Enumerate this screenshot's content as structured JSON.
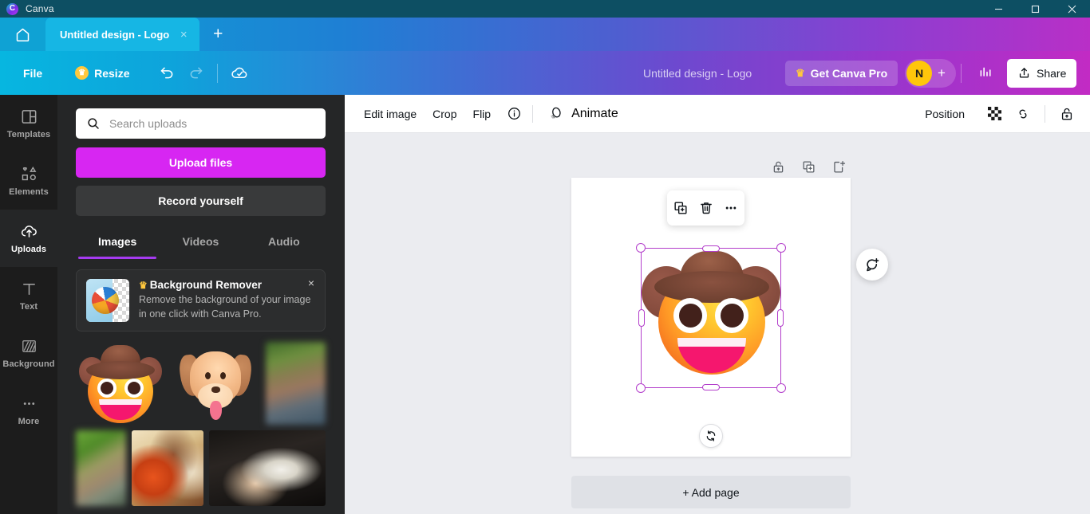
{
  "window": {
    "app_name": "Canva",
    "logo_letter": "C",
    "controls": {
      "minimize": "minimize-icon",
      "maximize": "maximize-icon",
      "close": "close-icon"
    }
  },
  "tabs": {
    "home_icon": "home-icon",
    "items": [
      {
        "label": "Untitled design - Logo",
        "active": true,
        "close": "×"
      }
    ],
    "new_tab": "+"
  },
  "toolbar": {
    "file_label": "File",
    "resize_label": "Resize",
    "resize_crown": "♛",
    "undo_icon": "undo-icon",
    "redo_icon": "redo-icon",
    "cloud_icon": "cloud-saved-icon",
    "doc_title": "Untitled design - Logo",
    "pro_label": "Get Canva Pro",
    "pro_crown": "♛",
    "avatar_initial": "N",
    "avatar_plus": "+",
    "stats_icon": "stats-icon",
    "share_label": "Share"
  },
  "rail": {
    "items": [
      {
        "label": "Templates",
        "icon": "templates-icon",
        "active": false
      },
      {
        "label": "Elements",
        "icon": "elements-icon",
        "active": false
      },
      {
        "label": "Uploads",
        "icon": "uploads-cloud-icon",
        "active": true
      },
      {
        "label": "Text",
        "icon": "text-icon",
        "active": false
      },
      {
        "label": "Background",
        "icon": "background-icon",
        "active": false
      },
      {
        "label": "More",
        "icon": "more-dots-icon",
        "active": false
      }
    ]
  },
  "panel": {
    "search": {
      "placeholder": "Search uploads",
      "value": "",
      "icon": "search-icon"
    },
    "upload_button": "Upload files",
    "record_button": "Record yourself",
    "tabs": [
      {
        "label": "Images",
        "active": true
      },
      {
        "label": "Videos",
        "active": false
      },
      {
        "label": "Audio",
        "active": false
      }
    ],
    "promo": {
      "crown": "♛",
      "title": "Background Remover",
      "description": "Remove the background of your image in one click with Canva Pro.",
      "close": "×",
      "thumb": "beach-ball-transparency-thumbnail"
    },
    "uploads": [
      {
        "name": "cowboy-emoji",
        "kind": "emoji-cowboy"
      },
      {
        "name": "dog-emoji",
        "kind": "emoji-dog"
      },
      {
        "name": "blurred-portrait-photo",
        "kind": "photo-blur-1"
      },
      {
        "name": "blurred-outdoor-photo",
        "kind": "photo-blur-2"
      },
      {
        "name": "tango-dancers-painting",
        "kind": "painting"
      },
      {
        "name": "dancing-couple-photo",
        "kind": "photo"
      }
    ]
  },
  "collapse_handle": {
    "icon": "chevron-left-icon"
  },
  "editor": {
    "tools": [
      {
        "label": "Edit image",
        "name": "edit-image"
      },
      {
        "label": "Crop",
        "name": "crop"
      },
      {
        "label": "Flip",
        "name": "flip"
      }
    ],
    "info_icon": "info-icon",
    "animate_label": "Animate",
    "animate_icon": "animate-icon",
    "position_label": "Position",
    "transparency_icon": "transparency-icon",
    "copy_style_icon": "link-style-icon",
    "lock_icon": "unlock-icon",
    "page_controls": [
      {
        "name": "lock-page",
        "icon": "lock-icon"
      },
      {
        "name": "duplicate-page",
        "icon": "duplicate-page-icon"
      },
      {
        "name": "add-page",
        "icon": "add-page-icon"
      }
    ],
    "element_toolbar": [
      {
        "name": "duplicate-element",
        "icon": "duplicate-icon"
      },
      {
        "name": "delete-element",
        "icon": "trash-icon"
      },
      {
        "name": "more-options",
        "icon": "more-dots-icon"
      }
    ],
    "selection": {
      "element": "cowboy-emoji",
      "rotate_icon": "rotate-icon"
    },
    "comment_fab": "add-comment-icon",
    "add_page_label": "+ Add page"
  },
  "colors": {
    "titlebar": "#0d4f63",
    "brand_magenta": "#d726f2",
    "selection_purple": "#b33ecb",
    "avatar_yellow": "#ffc60b",
    "panel_bg": "#252627",
    "rail_bg": "#1c1c1c",
    "editor_bg": "#ebecf0",
    "tab_active": "#16b6e4"
  }
}
